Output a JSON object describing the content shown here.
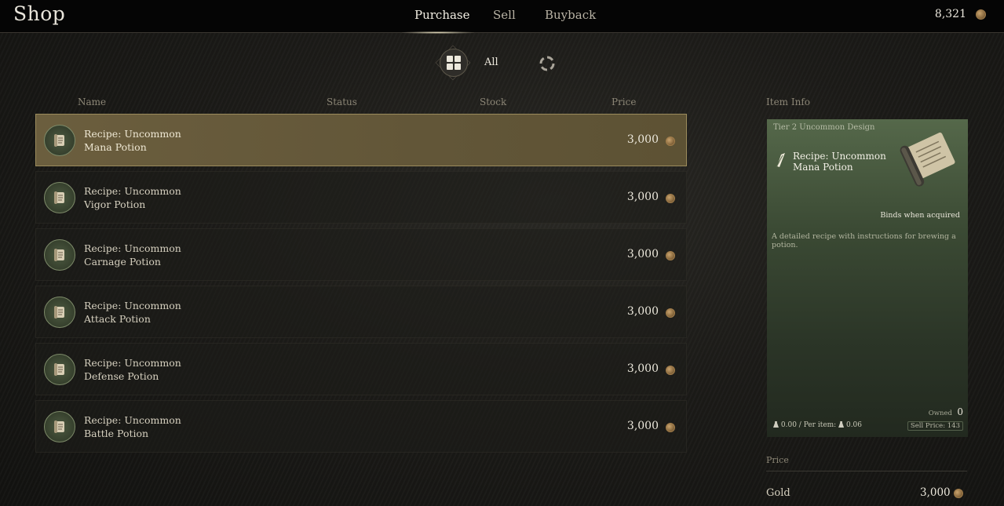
{
  "header": {
    "title": "Shop",
    "tabs": [
      {
        "label": "Purchase",
        "active": true
      },
      {
        "label": "Sell",
        "active": false
      },
      {
        "label": "Buyback",
        "active": false
      }
    ],
    "currency_amount": "8,321",
    "currency_icon": "gold-coin-icon"
  },
  "filter": {
    "category_label": "All",
    "category_icon": "grid-icon",
    "reset_icon": "cycle-icon"
  },
  "columns": {
    "name": "Name",
    "status": "Status",
    "stock": "Stock",
    "price": "Price"
  },
  "items": [
    {
      "name": "Recipe: Uncommon Mana Potion",
      "price": "3,000",
      "selected": true
    },
    {
      "name": "Recipe: Uncommon Vigor Potion",
      "price": "3,000",
      "selected": false
    },
    {
      "name": "Recipe: Uncommon Carnage Potion",
      "price": "3,000",
      "selected": false
    },
    {
      "name": "Recipe: Uncommon Attack Potion",
      "price": "3,000",
      "selected": false
    },
    {
      "name": "Recipe: Uncommon Defense Potion",
      "price": "3,000",
      "selected": false
    },
    {
      "name": "Recipe: Uncommon Battle Potion",
      "price": "3,000",
      "selected": false
    }
  ],
  "item_info": {
    "section_label": "Item Info",
    "tier": "Tier 2  Uncommon  Design",
    "name": "Recipe: Uncommon Mana Potion",
    "binds": "Binds when acquired",
    "description": "A detailed recipe with instructions for brewing a potion.",
    "owned_label": "Owned",
    "owned_value": "0",
    "weight": "0.00",
    "per_item_label": "/ Per item:",
    "per_item_weight": "0.06",
    "sell_price": "Sell Price: 143",
    "card_color": "#55684a"
  },
  "price_section": {
    "label": "Price",
    "currency_name": "Gold",
    "amount": "3,000"
  },
  "colors": {
    "selected_row": "#6b5e3e",
    "background": "#1c1b18",
    "accent_gold": "#c9a36d"
  }
}
